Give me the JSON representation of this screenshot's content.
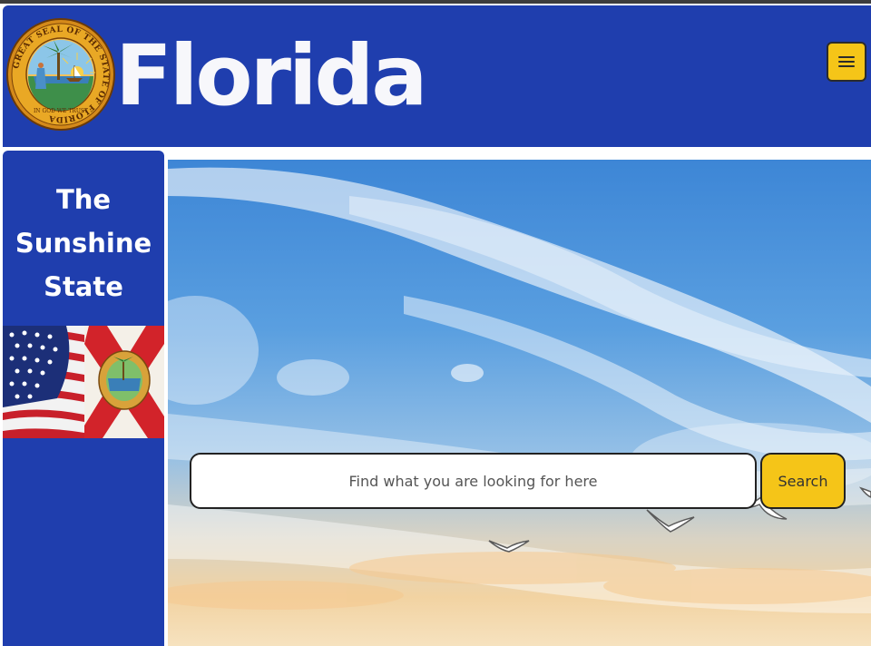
{
  "header": {
    "title": "Florida",
    "seal": {
      "icon": "state-seal-icon",
      "ring_text": "GREAT SEAL OF THE STATE OF FLORIDA",
      "motto": "IN GOD WE TRUST"
    },
    "menu": {
      "icon": "hamburger-menu-icon"
    }
  },
  "sidebar": {
    "tagline": [
      "The",
      "Sunshine",
      "State"
    ],
    "flag_image": {
      "icon": "us-and-florida-flags-image"
    }
  },
  "hero": {
    "image": "sky-with-seagulls-image",
    "search": {
      "placeholder": "Find what you are looking for here",
      "value": "",
      "button_label": "Search"
    }
  },
  "colors": {
    "brand_blue": "#1f3eae",
    "accent_yellow": "#f5c518",
    "title_text": "#f7f7fb",
    "window_chrome": "#3d3d3d"
  }
}
